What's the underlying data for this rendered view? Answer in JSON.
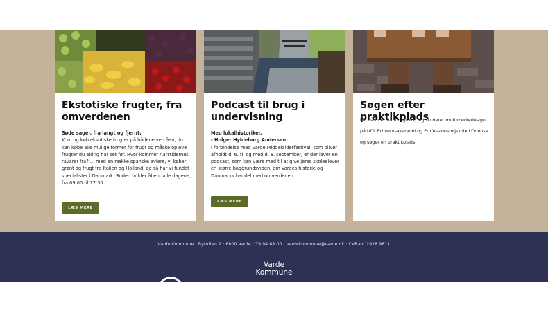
{
  "cards": [
    {
      "title": "Ekstotiske frugter, fra omverdenen",
      "subtitle": "Søde sager, fra langt og fjernt:",
      "text": "Kom og køb eksotiske frugter på bådene ved åen, du kan købe alle mulige former for frugt og måske opleve frugter du aldrig har set før. Hvor kommer Aarstidernes råvarer fra? ... med en række spanske avlere, vi køber grønt og frugt fra Italien og Holland, og så har vi fundet specialister i Danmark. Boden holder åbent alle dagene, fra 09:00 til 17:30.",
      "button": "LÆS MERE",
      "image_icon": "fruit-market-photo"
    },
    {
      "title": "Podcast til brug i undervisning",
      "subtitle_line1": "Med lokalhistoriker,",
      "subtitle_line2": "- Holger Hyldeborg Andersen:",
      "text": "I forbindelse med Varde Middelalderfestival, som bliver afholdt d. 6. til og med d. 8. september, er der lavet en podcast, som kan være med til at give jeres skoleelever en større baggrundsviden, om Vardes historie og Danmarks handel med omverdenen.",
      "button": "LÆS MERE",
      "image_icon": "medieval-knights-photo"
    },
    {
      "title": "Søgen efter praktikplads",
      "text": "Mit navn er Rani Lagfoss, jeg studerer multimediedesign på UCL Erhvervsakademi og Professionshøjskole i Odense og søger en praktikplads",
      "image_icon": "pillory-photo"
    }
  ],
  "footer": {
    "info": "Varde Kommune · Bytoften 2 · 6800 Varde · 79 94 68 00 · vardekommune@varde.dk · CVR-nr. 2918 9811",
    "logo_line1": "Varde",
    "logo_line2": "Kommune"
  },
  "colors": {
    "band": "#c4b29a",
    "footer": "#2d3153",
    "button": "#5b6b28"
  }
}
